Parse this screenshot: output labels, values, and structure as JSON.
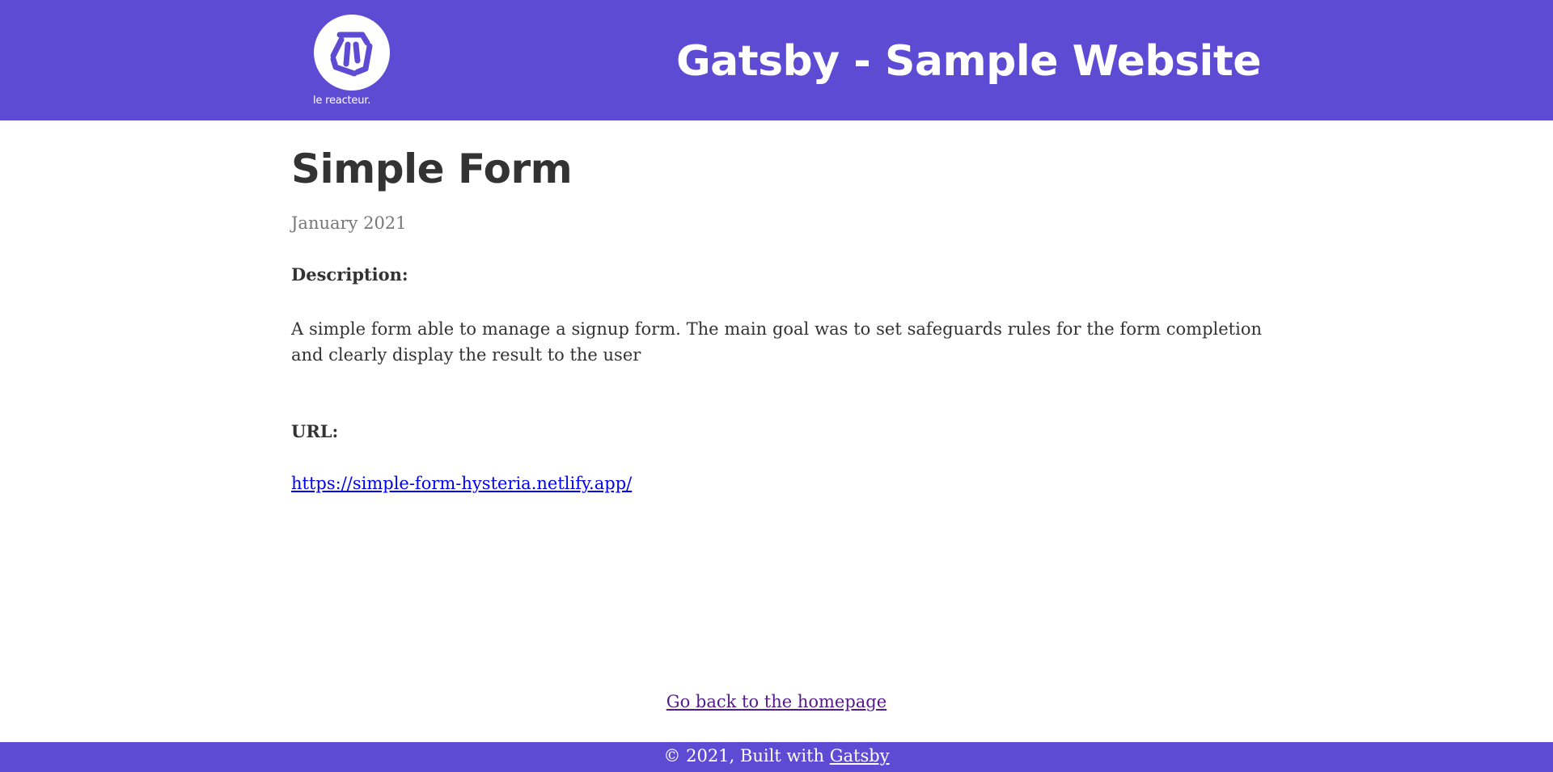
{
  "header": {
    "site_title": "Gatsby - Sample Website",
    "logo_text": "le reacteur.",
    "background_color": "#5d4bd4"
  },
  "post": {
    "title": "Simple Form",
    "date": "January 2021",
    "description_label": "Description:",
    "description": "A simple form able to manage a signup form. The main goal was to set safeguards rules for the form completion and clearly display the result to the user",
    "url_label": "URL:",
    "url": "https://simple-form-hysteria.netlify.app/"
  },
  "navigation": {
    "back_link": "Go back to the homepage"
  },
  "footer": {
    "prefix": "© 2021, Built with ",
    "link_text": "Gatsby"
  },
  "colors": {
    "brand": "#5d4bd4",
    "link": "#0000ee",
    "visited_link": "#551a8b",
    "text": "#333333",
    "muted": "#777777"
  }
}
